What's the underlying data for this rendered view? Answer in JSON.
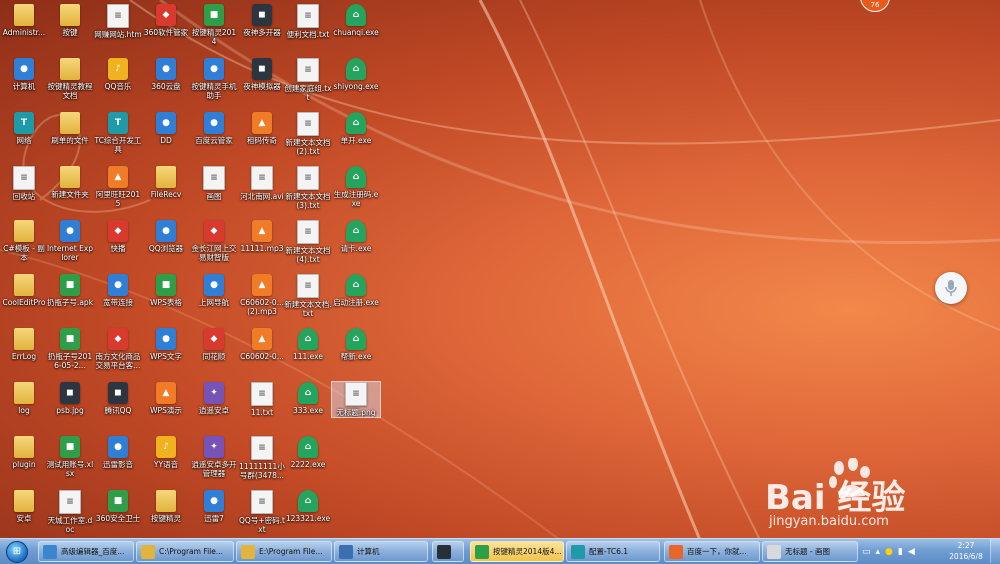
{
  "colors": {
    "wallpaper": "#e0683a",
    "folder": "#e2b33d",
    "taskbar": "#6f9dd3",
    "active_task": "#f1c34a"
  },
  "top_badge": "76",
  "desktop_icons": [
    {
      "label": "Administr...",
      "icon": "folder-icon",
      "kind": "folder"
    },
    {
      "label": "计算机",
      "icon": "computer-icon",
      "kind": "blue"
    },
    {
      "label": "网络",
      "icon": "network-icon",
      "kind": "teal"
    },
    {
      "label": "回收站",
      "icon": "recycle-bin-icon",
      "kind": "file"
    },
    {
      "label": "C#模板 - 副本",
      "icon": "folder-icon",
      "kind": "folder"
    },
    {
      "label": "CoolEditPro",
      "icon": "folder-icon",
      "kind": "folder"
    },
    {
      "label": "ErrLog",
      "icon": "folder-icon",
      "kind": "folder"
    },
    {
      "label": "log",
      "icon": "folder-icon",
      "kind": "folder"
    },
    {
      "label": "plugin",
      "icon": "folder-icon",
      "kind": "folder"
    },
    {
      "label": "安卓",
      "icon": "folder-icon",
      "kind": "folder"
    },
    {
      "label": "按键",
      "icon": "folder-icon",
      "kind": "folder"
    },
    {
      "label": "按键精灵教程文档",
      "icon": "folder-icon",
      "kind": "folder"
    },
    {
      "label": "刷单的文件",
      "icon": "folder-icon",
      "kind": "folder"
    },
    {
      "label": "新建文件夹",
      "icon": "folder-icon",
      "kind": "folder"
    },
    {
      "label": "Internet Explorer",
      "icon": "ie-icon",
      "kind": "blue"
    },
    {
      "label": "扔瓶子号.apk",
      "icon": "apk-icon",
      "kind": "green"
    },
    {
      "label": "扔瓶子号2016-05-2...",
      "icon": "apk-icon",
      "kind": "green"
    },
    {
      "label": "psb.jpg",
      "icon": "image-icon",
      "kind": "dark"
    },
    {
      "label": "测试用账号.xlsx",
      "icon": "excel-icon",
      "kind": "green"
    },
    {
      "label": "天城工作室.doc",
      "icon": "word-icon",
      "kind": "file"
    },
    {
      "label": "网赚网站.htm",
      "icon": "html-icon",
      "kind": "file"
    },
    {
      "label": "QQ音乐",
      "icon": "qq-music-icon",
      "kind": "yellow"
    },
    {
      "label": "TC综合开发工具",
      "icon": "tc-icon",
      "kind": "teal"
    },
    {
      "label": "阿里旺旺2015",
      "icon": "aliwangwang-icon",
      "kind": "orange"
    },
    {
      "label": "快播",
      "icon": "qvod-icon",
      "kind": "red"
    },
    {
      "label": "宽带连接",
      "icon": "broadband-icon",
      "kind": "blue"
    },
    {
      "label": "南方文化商品交易平台客...",
      "icon": "trading-icon",
      "kind": "red"
    },
    {
      "label": "腾讯QQ",
      "icon": "qq-icon",
      "kind": "dark"
    },
    {
      "label": "迅雷影音",
      "icon": "xunlei-player-icon",
      "kind": "blue"
    },
    {
      "label": "360安全卫士",
      "icon": "360-safe-icon",
      "kind": "green"
    },
    {
      "label": "360软件管家",
      "icon": "360-software-icon",
      "kind": "red"
    },
    {
      "label": "360云盘",
      "icon": "360-cloud-icon",
      "kind": "blue"
    },
    {
      "label": "DD",
      "icon": "dd-icon",
      "kind": "blue"
    },
    {
      "label": "FileRecv",
      "icon": "folder-icon",
      "kind": "folder"
    },
    {
      "label": "QQ浏览器",
      "icon": "qq-browser-icon",
      "kind": "blue"
    },
    {
      "label": "WPS表格",
      "icon": "wps-sheet-icon",
      "kind": "green"
    },
    {
      "label": "WPS文字",
      "icon": "wps-writer-icon",
      "kind": "blue"
    },
    {
      "label": "WPS演示",
      "icon": "wps-present-icon",
      "kind": "orange"
    },
    {
      "label": "YY语音",
      "icon": "yy-icon",
      "kind": "yellow"
    },
    {
      "label": "按键精灵",
      "icon": "anjian-icon",
      "kind": "folder"
    },
    {
      "label": "按键精灵2014",
      "icon": "anjian-icon",
      "kind": "green"
    },
    {
      "label": "按键精灵手机助手",
      "icon": "anjian-mobile-icon",
      "kind": "blue"
    },
    {
      "label": "百度云管家",
      "icon": "baidu-cloud-icon",
      "kind": "blue"
    },
    {
      "label": "画图",
      "icon": "paint-icon",
      "kind": "file"
    },
    {
      "label": "金长江网上交易财智版",
      "icon": "jinchangjiang-icon",
      "kind": "red"
    },
    {
      "label": "上网导航",
      "icon": "navigation-icon",
      "kind": "blue"
    },
    {
      "label": "同花顺",
      "icon": "tonghuashun-icon",
      "kind": "red"
    },
    {
      "label": "逍遥安卓",
      "icon": "xiaoyao-icon",
      "kind": "purple"
    },
    {
      "label": "逍遥安卓多开管理器",
      "icon": "xiaoyao-multi-icon",
      "kind": "purple"
    },
    {
      "label": "迅雷7",
      "icon": "xunlei-icon",
      "kind": "blue"
    },
    {
      "label": "夜神多开器",
      "icon": "nox-multi-icon",
      "kind": "dark"
    },
    {
      "label": "夜神模拟器",
      "icon": "nox-icon",
      "kind": "dark"
    },
    {
      "label": "租码传奇",
      "icon": "game-icon",
      "kind": "orange"
    },
    {
      "label": "河北南网.avi",
      "icon": "video-icon",
      "kind": "file"
    },
    {
      "label": "11111.mp3",
      "icon": "mp3-icon",
      "kind": "orange"
    },
    {
      "label": "C60602-0...(2).mp3",
      "icon": "mp3-icon",
      "kind": "orange"
    },
    {
      "label": "C60602-0...",
      "icon": "mp3-icon",
      "kind": "orange"
    },
    {
      "label": "11.txt",
      "icon": "text-file-icon",
      "kind": "file"
    },
    {
      "label": "11111111小号群(3478...",
      "icon": "text-file-icon",
      "kind": "file"
    },
    {
      "label": "QQ号+密码.txt",
      "icon": "text-file-icon",
      "kind": "file"
    },
    {
      "label": "便利文档.txt",
      "icon": "text-file-icon",
      "kind": "file"
    },
    {
      "label": "创建家庭组.txt",
      "icon": "text-file-icon",
      "kind": "file"
    },
    {
      "label": "新建文本文档(2).txt",
      "icon": "text-file-icon",
      "kind": "file"
    },
    {
      "label": "新建文本文档(3).txt",
      "icon": "text-file-icon",
      "kind": "file"
    },
    {
      "label": "新建文本文档(4).txt",
      "icon": "text-file-icon",
      "kind": "file"
    },
    {
      "label": "新建文本文档.txt",
      "icon": "text-file-icon",
      "kind": "file"
    },
    {
      "label": "111.exe",
      "icon": "exe-icon",
      "kind": "house"
    },
    {
      "label": "333.exe",
      "icon": "exe-icon",
      "kind": "house"
    },
    {
      "label": "2222.exe",
      "icon": "exe-icon",
      "kind": "house"
    },
    {
      "label": "123321.exe",
      "icon": "exe-icon",
      "kind": "house"
    },
    {
      "label": "chuanqi.exe",
      "icon": "exe-icon",
      "kind": "house"
    },
    {
      "label": "shiyong.exe",
      "icon": "exe-icon",
      "kind": "house"
    },
    {
      "label": "单开.exe",
      "icon": "exe-icon",
      "kind": "house"
    },
    {
      "label": "生成注册码.exe",
      "icon": "exe-icon",
      "kind": "house"
    },
    {
      "label": "请卡.exe",
      "icon": "exe-icon",
      "kind": "house"
    },
    {
      "label": "启动注册.exe",
      "icon": "exe-icon",
      "kind": "house"
    },
    {
      "label": "帮新.exe",
      "icon": "exe-icon",
      "kind": "house"
    },
    {
      "label": "无标题.png",
      "icon": "png-icon",
      "kind": "file",
      "selected": true
    }
  ],
  "watermark": {
    "main": "Bai 经验",
    "sub": "jingyan.baidu.com"
  },
  "taskbar": {
    "start_icon": "windows-orb-icon",
    "buttons": [
      {
        "label": "高级编辑器_百度...",
        "icon": "browser-icon"
      },
      {
        "label": "C:\\Program File...",
        "icon": "folder-icon"
      },
      {
        "label": "E:\\Program File...",
        "icon": "folder-icon"
      },
      {
        "label": "计算机",
        "icon": "computer-icon"
      },
      {
        "label": "",
        "icon": "nox-icon"
      },
      {
        "label": "按键精灵2014版4...",
        "icon": "anjian-icon",
        "active": true
      },
      {
        "label": "配置-TC6.1",
        "icon": "tc-icon"
      },
      {
        "label": "百度一下，你就...",
        "icon": "firefox-icon"
      },
      {
        "label": "无标题 - 画图",
        "icon": "paint-icon"
      }
    ],
    "clock_time": "2:27",
    "clock_date": "2016/6/8"
  }
}
